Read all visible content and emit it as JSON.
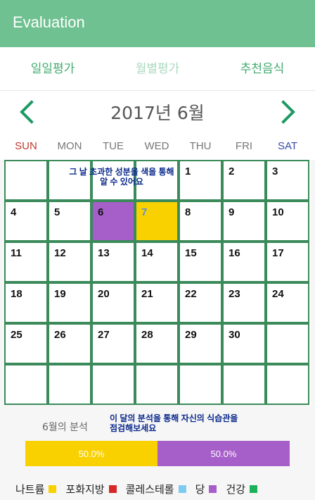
{
  "appbar": {
    "title": "Evaluation"
  },
  "tabs": [
    {
      "label": "일일평가"
    },
    {
      "label": "월별평가"
    },
    {
      "label": "추천음식"
    }
  ],
  "calendar": {
    "month_label": "2017년 6월",
    "weekdays": [
      "SUN",
      "MON",
      "TUE",
      "WED",
      "THU",
      "FRI",
      "SAT"
    ],
    "days": [
      "",
      "",
      "",
      "",
      "1",
      "2",
      "3",
      "4",
      "5",
      "6",
      "7",
      "8",
      "9",
      "10",
      "11",
      "12",
      "13",
      "14",
      "15",
      "16",
      "17",
      "18",
      "19",
      "20",
      "21",
      "22",
      "23",
      "24",
      "25",
      "26",
      "27",
      "28",
      "29",
      "30",
      "",
      "",
      "",
      "",
      "",
      "",
      "",
      ""
    ],
    "highlights": {
      "6": "#a65ec9",
      "7": "#f9d100"
    },
    "hint_text": "그 날 초과한 성분을 색을 통해 알 수 있어요"
  },
  "analysis": {
    "label": "6월의 분석",
    "hint_text": "이 달의 분석을 통해 자신의 식습관을 점검해보세요",
    "segments": [
      {
        "label": "50.0%",
        "fraction": 0.5,
        "color": "#f9d100"
      },
      {
        "label": "50.0%",
        "fraction": 0.5,
        "color": "#a65ec9"
      }
    ]
  },
  "legend": [
    {
      "label": "나트륨",
      "color": "#f9d100"
    },
    {
      "label": "포화지방",
      "color": "#d62828"
    },
    {
      "label": "콜레스테롤",
      "color": "#7ecbf0"
    },
    {
      "label": "당",
      "color": "#a65ec9"
    },
    {
      "label": "건강",
      "color": "#1db25a"
    }
  ],
  "colors": {
    "accent": "#6fc191",
    "grid_border": "#3a8a5a",
    "hint_text": "#0b2a8c"
  }
}
